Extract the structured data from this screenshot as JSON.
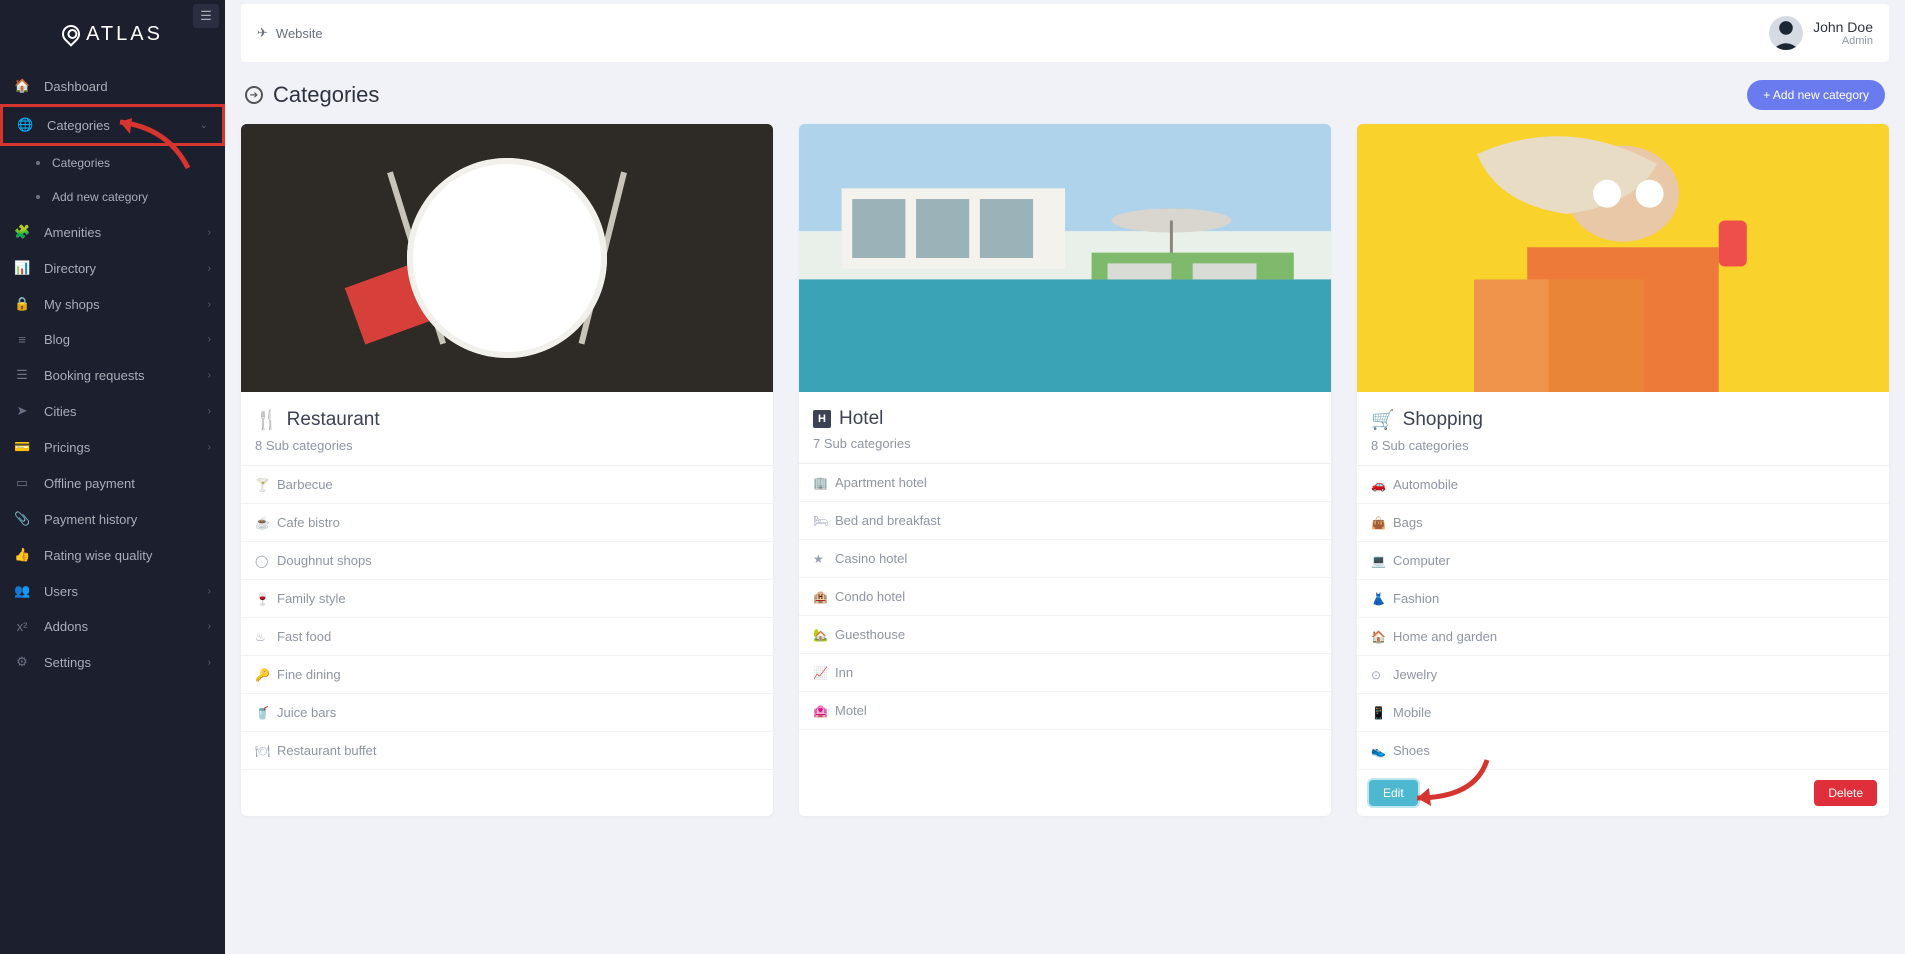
{
  "brand": "ATLAS",
  "topbar": {
    "website": "Website",
    "user_name": "John Doe",
    "user_role": "Admin"
  },
  "page": {
    "title": "Categories",
    "add_button": "+ Add new category"
  },
  "sidebar": {
    "items": [
      {
        "label": "Dashboard",
        "icon": "🏠",
        "chev": false
      },
      {
        "label": "Categories",
        "icon": "🌐",
        "chev": true,
        "highlight": true
      },
      {
        "label": "Amenities",
        "icon": "🧩",
        "chev": true
      },
      {
        "label": "Directory",
        "icon": "📊",
        "chev": true
      },
      {
        "label": "My shops",
        "icon": "🔒",
        "chev": true
      },
      {
        "label": "Blog",
        "icon": "≡",
        "chev": true
      },
      {
        "label": "Booking requests",
        "icon": "☰",
        "chev": true
      },
      {
        "label": "Cities",
        "icon": "➤",
        "chev": true
      },
      {
        "label": "Pricings",
        "icon": "💳",
        "chev": true
      },
      {
        "label": "Offline payment",
        "icon": "▭",
        "chev": false
      },
      {
        "label": "Payment history",
        "icon": "📎",
        "chev": false
      },
      {
        "label": "Rating wise quality",
        "icon": "👍",
        "chev": false
      },
      {
        "label": "Users",
        "icon": "👥",
        "chev": true
      },
      {
        "label": "Addons",
        "icon": "x²",
        "chev": true
      },
      {
        "label": "Settings",
        "icon": "⚙",
        "chev": true
      }
    ],
    "sub_categories": [
      {
        "label": "Categories"
      },
      {
        "label": "Add new category"
      }
    ]
  },
  "cards": [
    {
      "title": "Restaurant",
      "icon": "🍴",
      "sub_count": "8 Sub categories",
      "subs": [
        {
          "icon": "🍸",
          "label": "Barbecue"
        },
        {
          "icon": "☕",
          "label": "Cafe bistro"
        },
        {
          "icon": "◯",
          "label": "Doughnut shops"
        },
        {
          "icon": "🍷",
          "label": "Family style"
        },
        {
          "icon": "♨",
          "label": "Fast food"
        },
        {
          "icon": "🔑",
          "label": "Fine dining"
        },
        {
          "icon": "🥤",
          "label": "Juice bars"
        },
        {
          "icon": "🍽",
          "label": "Restaurant buffet"
        }
      ]
    },
    {
      "title": "Hotel",
      "icon": "H",
      "sub_count": "7 Sub categories",
      "subs": [
        {
          "icon": "🏢",
          "label": "Apartment hotel"
        },
        {
          "icon": "🛏",
          "label": "Bed and breakfast"
        },
        {
          "icon": "★",
          "label": "Casino hotel"
        },
        {
          "icon": "🏨",
          "label": "Condo hotel"
        },
        {
          "icon": "🏡",
          "label": "Guesthouse"
        },
        {
          "icon": "📈",
          "label": "Inn"
        },
        {
          "icon": "🏩",
          "label": "Motel"
        }
      ]
    },
    {
      "title": "Shopping",
      "icon": "🛒",
      "sub_count": "8 Sub categories",
      "subs": [
        {
          "icon": "🚗",
          "label": "Automobile"
        },
        {
          "icon": "👜",
          "label": "Bags"
        },
        {
          "icon": "💻",
          "label": "Computer"
        },
        {
          "icon": "👗",
          "label": "Fashion"
        },
        {
          "icon": "🏠",
          "label": "Home and garden"
        },
        {
          "icon": "⊙",
          "label": "Jewelry"
        },
        {
          "icon": "📱",
          "label": "Mobile"
        },
        {
          "icon": "👟",
          "label": "Shoes"
        }
      ],
      "actions": {
        "edit": "Edit",
        "delete": "Delete"
      }
    }
  ]
}
